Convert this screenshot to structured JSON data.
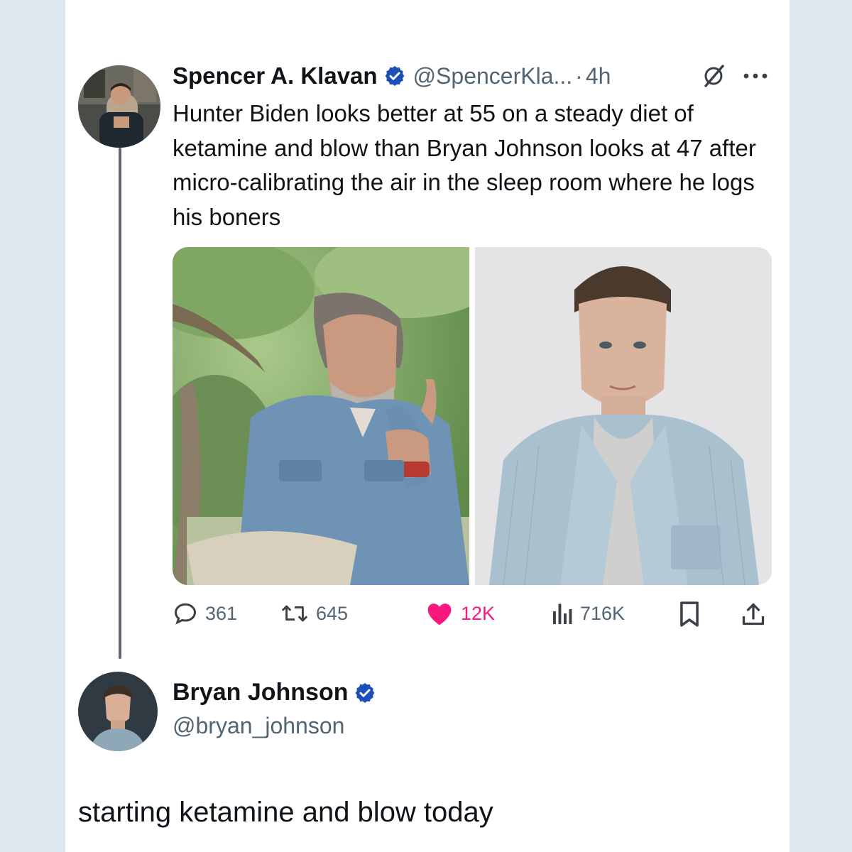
{
  "colors": {
    "page_background": "#dbe6ee",
    "card_background": "#ffffff",
    "text_primary": "#0f1419",
    "text_secondary": "#536471",
    "verified_blue": "#1d9bf0",
    "like_pink": "#f91880",
    "thread_line": "#5f6870"
  },
  "quoted_tweet": {
    "author_name": "Spencer A. Klavan",
    "verified": true,
    "handle": "@SpencerKla...",
    "separator": "·",
    "time": "4h",
    "grok_icon": "grok-icon",
    "more_icon": "more-dots-icon",
    "text": "Hunter Biden looks better at 55 on a steady diet of ketamine and blow than Bryan Johnson looks at 47 after micro-calibrating the air in the sleep room where he logs his boners",
    "media": [
      {
        "name": "left-photo",
        "subject": "man in denim shirt outdoors under tree, gesturing"
      },
      {
        "name": "right-photo",
        "subject": "man in light blue corduroy shirt against grey studio wall"
      }
    ],
    "stats": {
      "replies": "361",
      "reposts": "645",
      "likes": "12K",
      "liked": true,
      "views": "716K"
    },
    "action_icons": [
      "reply-icon",
      "repost-icon",
      "heart-icon",
      "views-icon",
      "bookmark-icon",
      "share-icon"
    ]
  },
  "reply_tweet": {
    "author_name": "Bryan Johnson",
    "verified": true,
    "handle": "@bryan_johnson",
    "text": "starting ketamine and blow today"
  }
}
